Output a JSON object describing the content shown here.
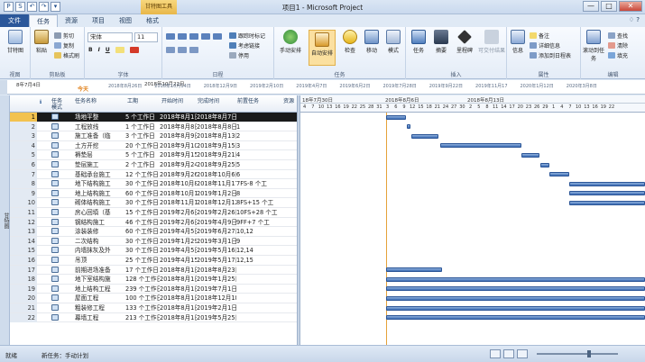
{
  "window": {
    "title": "项目1 - Microsoft Project",
    "context_tab": "甘特图工具",
    "quick_access": [
      "P",
      "S",
      "↶",
      "↷",
      "▾"
    ],
    "controls": [
      "—",
      "□",
      "✕"
    ]
  },
  "tabs": [
    "文件",
    "任务",
    "资源",
    "项目",
    "视图",
    "格式"
  ],
  "active_tab": "任务",
  "help": "♢ ?",
  "ribbon": {
    "view": {
      "label": "甘特图",
      "group": "视图"
    },
    "clipboard": {
      "paste": "粘贴",
      "cut": "剪切",
      "copy": "复制",
      "painter": "格式刷",
      "group": "剪贴板"
    },
    "font": {
      "name": "宋体",
      "size": "11",
      "group": "字体"
    },
    "schedule": {
      "respect_links": "跟踪时标记",
      "relink": "考虑链接",
      "inactivate": "停用",
      "group": "日程"
    },
    "tasks": {
      "manual": "手动安排",
      "auto": "自动安排",
      "inspect": "检查",
      "move": "移动",
      "mode": "模式",
      "group": "任务"
    },
    "insert": {
      "task": "任务",
      "summary": "摘要",
      "milestone": "里程碑",
      "deliverable": "可交付结果",
      "group": "插入"
    },
    "properties": {
      "info": "信息",
      "notes": "备注",
      "details": "详细信息",
      "add_timeline": "添加到日程表",
      "group": "属性"
    },
    "editing": {
      "scroll": "滚动到任务",
      "find": "查找",
      "clear": "清除",
      "fill": "填充",
      "group": "编辑"
    }
  },
  "timeline": {
    "label": "日程表",
    "start": "8年7月4日",
    "today": "今天",
    "marker": "2018年10月22日",
    "dates": [
      "2018年8月26日",
      "2018年10月14日",
      "2018年12月9日",
      "2019年2月10日",
      "2019年4月7日",
      "2019年6月2日",
      "2019年7月28日",
      "2019年9月22日",
      "2019年11月17",
      "2020年1月12日",
      "2020年3月8日"
    ]
  },
  "grid": {
    "headers": [
      "任务模式",
      "任务名称",
      "工期",
      "开始时间",
      "完成时间",
      "前置任务",
      "资源"
    ],
    "rows": [
      [
        "场地平整",
        "5 个工作日",
        "2018年8月1日",
        "2018年8月7日",
        ""
      ],
      [
        "工程放线",
        "1 个工作日",
        "2018年8月8日",
        "2018年8月8日",
        "1"
      ],
      [
        "施工准备（临",
        "3 个工作日",
        "2018年8月9日",
        "2018年8月13日",
        "2"
      ],
      [
        "土方开挖",
        "20 个工作日",
        "2018年9月10日",
        "2018年9月15日",
        "3"
      ],
      [
        "褥垫层",
        "5 个工作日",
        "2018年9月15日",
        "2018年9月21日",
        "4"
      ],
      [
        "垫层施工",
        "2 个工作日",
        "2018年9月24日",
        "2018年9月25日",
        "5"
      ],
      [
        "基础承台施工",
        "12 个工作日",
        "2018年9月26日",
        "2018年10月6日",
        "6"
      ],
      [
        "地下结构施工",
        "30 个工作日",
        "2018年10月8日",
        "2018年11月17日",
        "7FS-8 个工"
      ],
      [
        "地上结构施工",
        "60 个工作日",
        "2018年10月1日",
        "2019年1月2日",
        "8"
      ],
      [
        "砌体结构施工",
        "30 个工作日",
        "2018年11月1日",
        "2018年12月12日",
        "8FS+15 个工"
      ],
      [
        "房心回填（基",
        "15 个工作日",
        "2019年2月6日",
        "2019年2月26日",
        "10FS+28 个工"
      ],
      [
        "钢结构施工",
        "46 个工作日",
        "2019年2月6日",
        "2019年4月9日",
        "9FF+7 个工"
      ],
      [
        "涂装装修",
        "60 个工作日",
        "2019年4月5日",
        "2019年6月27日",
        "10,12"
      ],
      [
        "二次结构",
        "30 个工作日",
        "2019年1月29日",
        "2019年3月1日",
        "9"
      ],
      [
        "内墙抹灰及外",
        "30 个工作日",
        "2019年4月5日",
        "2019年5月16日",
        "12,14"
      ],
      [
        "吊顶",
        "25 个工作日",
        "2019年4月15日",
        "2019年5月17日",
        "12,15"
      ],
      [
        "前期进场准备",
        "17 个工作日",
        "2018年8月1日",
        "2018年8月23日",
        ""
      ],
      [
        "地下室结构施",
        "128 个工作日",
        "2018年8月1日",
        "2019年1月25日",
        ""
      ],
      [
        "地上结构工程",
        "239 个工作日",
        "2018年8月1日",
        "2019年7月1日",
        ""
      ],
      [
        "屋面工程",
        "100 个工作日",
        "2018年8月1日",
        "2018年12月18日",
        ""
      ],
      [
        "粗装修工程",
        "133 个工作日",
        "2018年8月1日",
        "2019年2月1日",
        ""
      ],
      [
        "幕墙工程",
        "213 个工作日",
        "2018年8月1日",
        "2019年5月25日",
        ""
      ]
    ]
  },
  "gantt": {
    "week_labels": [
      "18年7月30日",
      "2018年8月6日",
      "2018年8月13日"
    ],
    "day_letters": [
      "4",
      "7",
      "10",
      "13",
      "16",
      "19",
      "22",
      "25",
      "28",
      "31",
      "3",
      "6",
      "9",
      "12",
      "15",
      "18",
      "21",
      "24",
      "27",
      "30",
      "2",
      "5",
      "8",
      "11",
      "14",
      "17",
      "20",
      "23",
      "26",
      "29",
      "1",
      "4",
      "7",
      "10",
      "13",
      "16",
      "19",
      "22"
    ]
  },
  "status": {
    "mode": "就绪",
    "new_tasks": "新任务：手动计划"
  },
  "colors": {
    "bar": "#3c6cb4",
    "file_tab": "#2b579a",
    "today_line": "#e6a23a",
    "selection": "#1a1a1a"
  }
}
